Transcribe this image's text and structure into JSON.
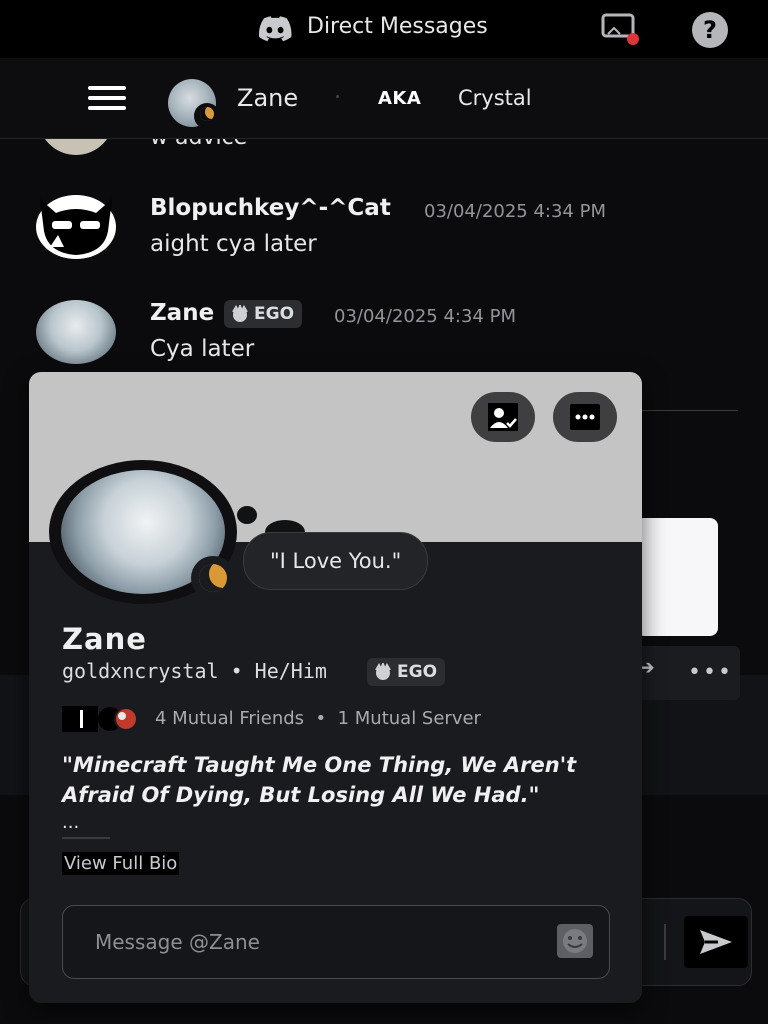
{
  "topbar": {
    "title": "Direct Messages"
  },
  "header": {
    "name": "Zane",
    "aka_label": "AKA",
    "nickname": "Crystal"
  },
  "messages": [
    {
      "content": "w advice"
    },
    {
      "author": "Blopuchkey^-^Cat",
      "timestamp": "03/04/2025 4:34 PM",
      "content": "aight cya later"
    },
    {
      "author": "Zane",
      "tag": "EGO",
      "timestamp": "03/04/2025 4:34 PM",
      "content": "Cya later"
    }
  ],
  "profile": {
    "status_bubble": "\"I Love You.\"",
    "display_name": "Zane",
    "username_pronouns": "goldxncrystal • He/Him",
    "tag": "EGO",
    "mutual_friends": "4 Mutual Friends",
    "separator": "•",
    "mutual_server": "1 Mutual Server",
    "bio": "\"Minecraft Taught Me One Thing, We Aren't Afraid Of Dying, But Losing All We Had.\"",
    "bio_more": "...",
    "view_full_bio": "View Full Bio",
    "message_placeholder": "Message @Zane"
  },
  "colors": {
    "status_idle": "#d99a36",
    "banner": "#c4c4c4",
    "background": "#0b0b0d",
    "accent_red": "#e0343a"
  }
}
